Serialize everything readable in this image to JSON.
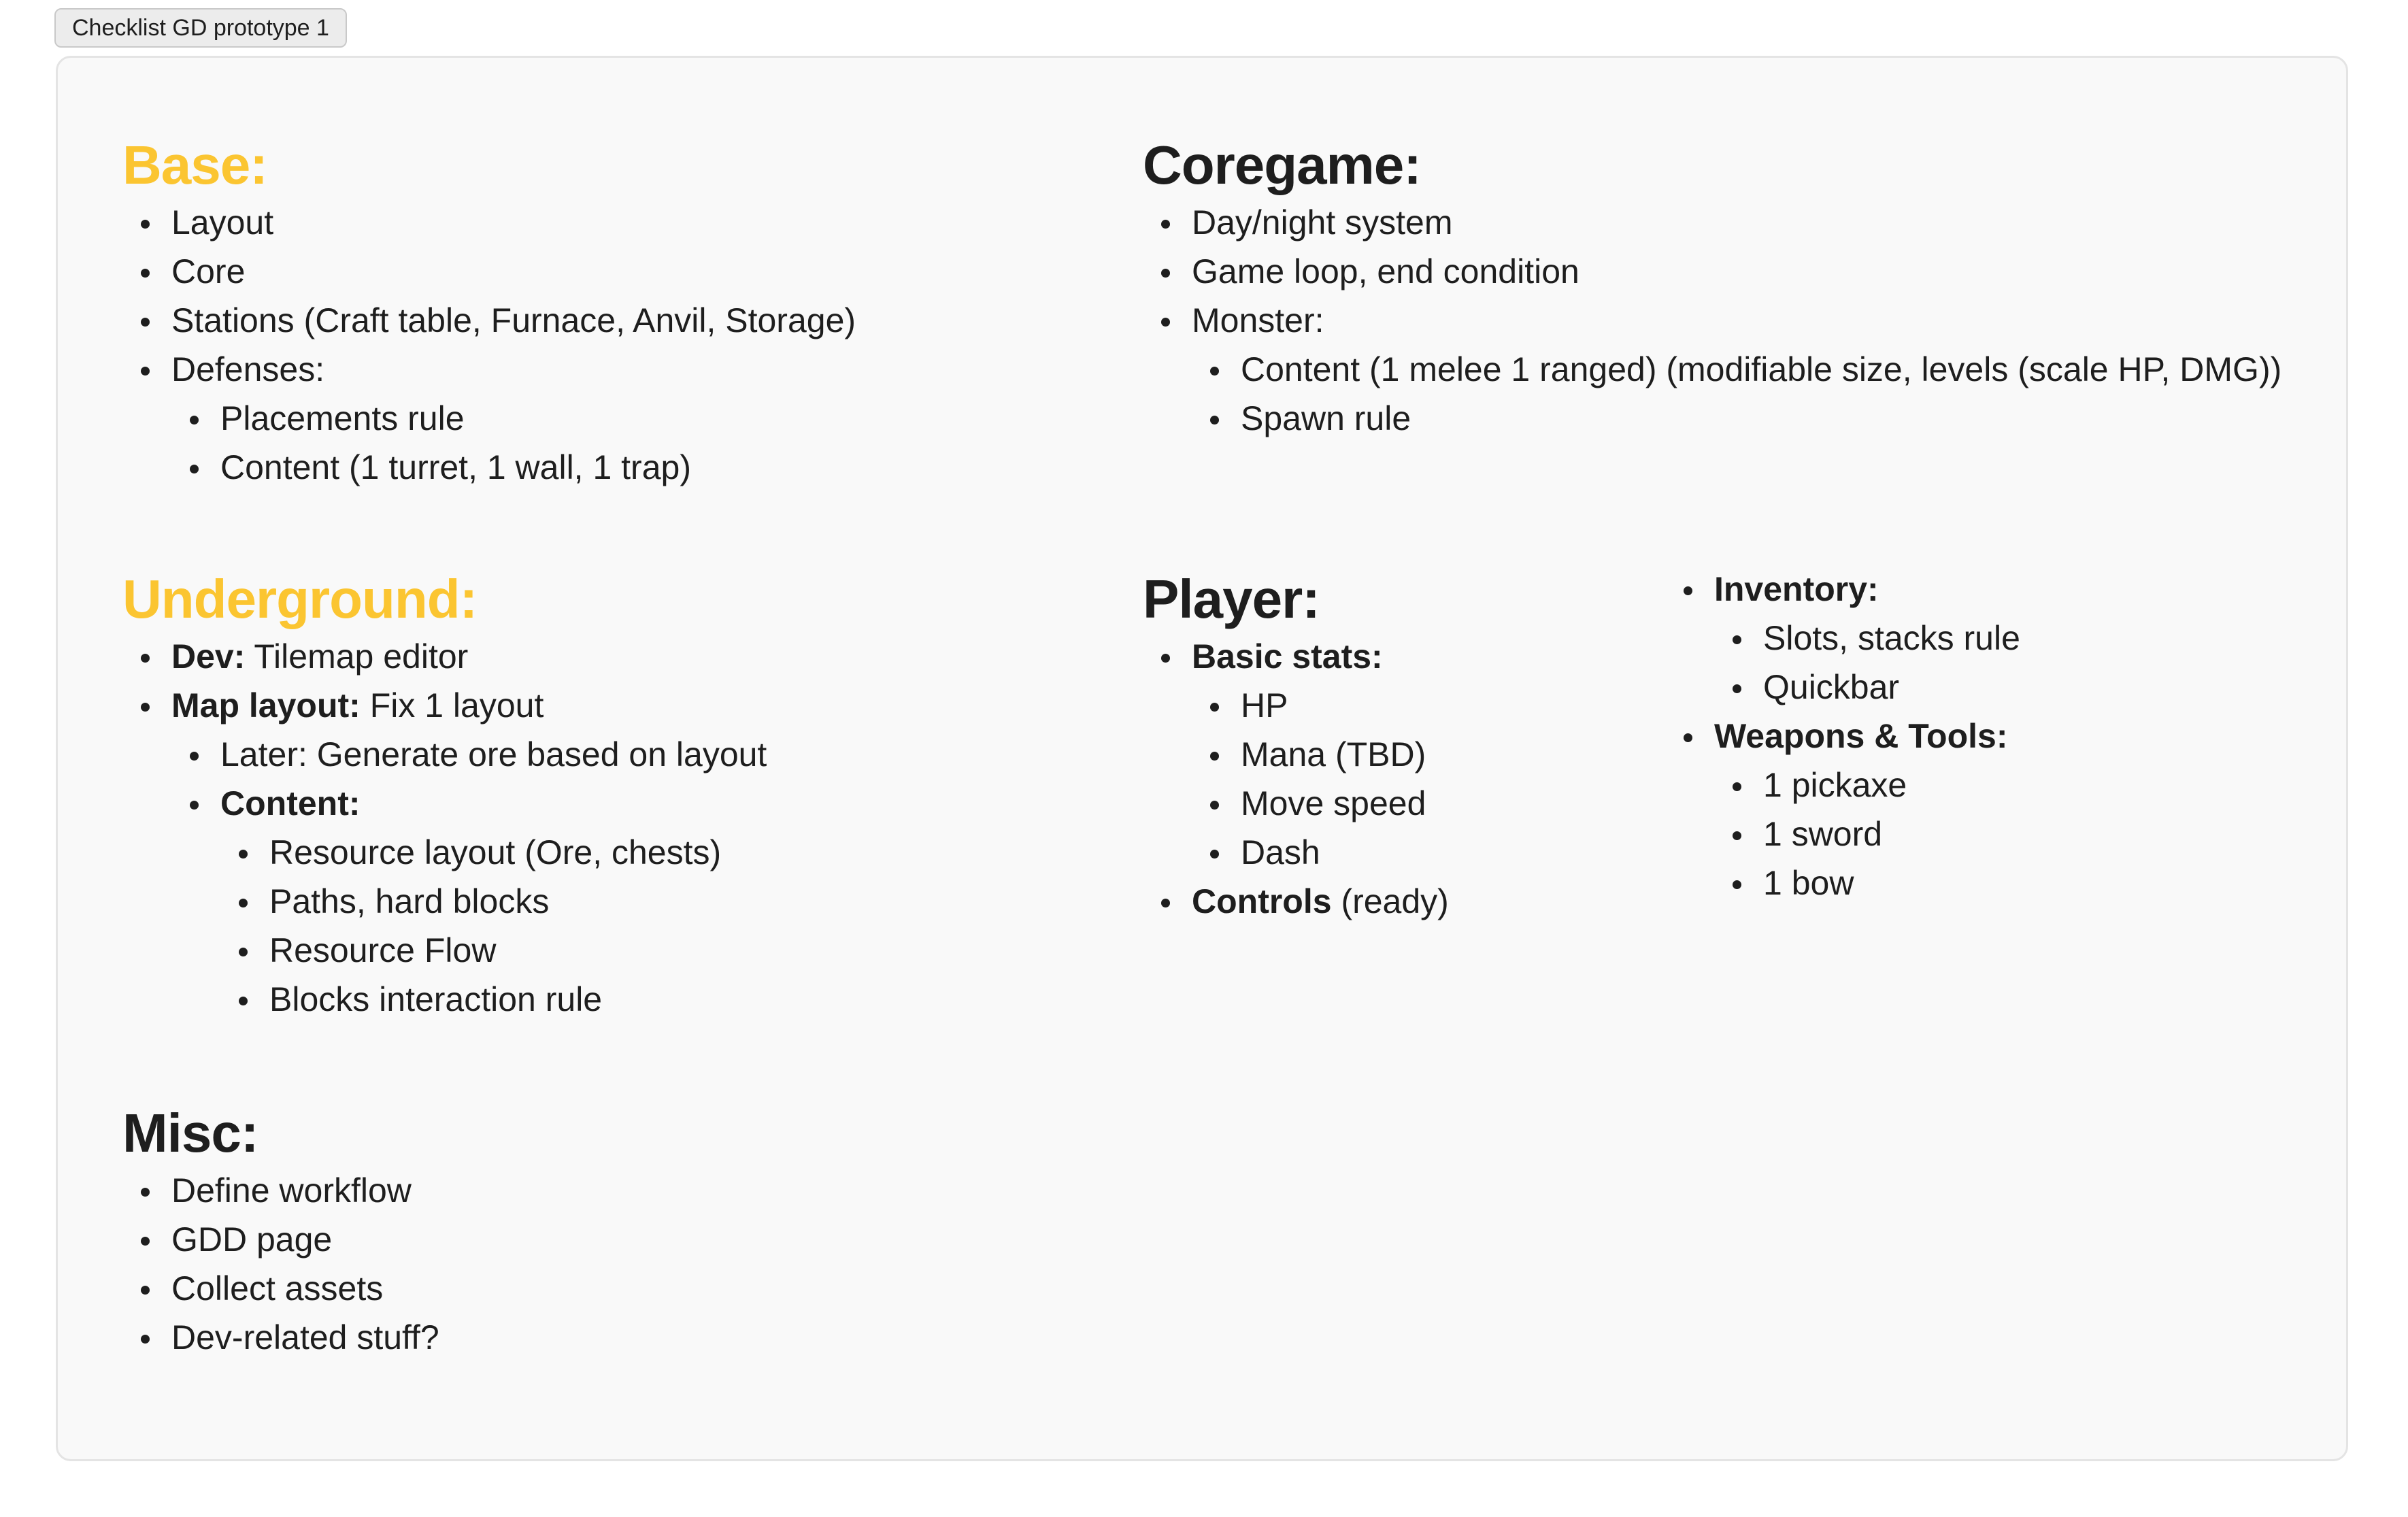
{
  "frame": {
    "title": "Checklist GD prototype 1"
  },
  "base": {
    "title": "Base:",
    "items": [
      "Layout",
      "Core",
      "Stations (Craft table, Furnace, Anvil, Storage)",
      "Defenses:"
    ],
    "defenses": [
      "Placements rule",
      "Content (1 turret, 1 wall, 1 trap)"
    ]
  },
  "coregame": {
    "title": "Coregame:",
    "items": [
      "Day/night system",
      "Game loop, end condition",
      "Monster:"
    ],
    "monster": [
      "Content (1 melee 1 ranged) (modifiable size, levels (scale HP, DMG))",
      "Spawn rule"
    ]
  },
  "underground": {
    "title": "Underground:",
    "dev_label": "Dev:",
    "dev_text": " Tilemap editor",
    "map_label": "Map layout:",
    "map_text": " Fix 1 layout",
    "later": "Later: Generate ore based on layout",
    "content_label": "Content:",
    "content": [
      "Resource layout (Ore, chests)",
      "Paths, hard blocks",
      "Resource Flow",
      "Blocks interaction rule"
    ]
  },
  "player": {
    "title": "Player:",
    "stats_label": "Basic stats:",
    "stats": [
      "HP",
      "Mana (TBD)",
      "Move speed",
      "Dash"
    ],
    "controls_label": "Controls",
    "controls_text": " (ready)",
    "inventory_label": "Inventory:",
    "inventory": [
      "Slots, stacks rule",
      "Quickbar"
    ],
    "weapons_label": "Weapons & Tools:",
    "weapons": [
      "1 pickaxe",
      "1 sword",
      "1 bow"
    ]
  },
  "misc": {
    "title": "Misc:",
    "items": [
      "Define workflow",
      "GDD page",
      "Collect assets",
      "Dev-related stuff?"
    ]
  }
}
